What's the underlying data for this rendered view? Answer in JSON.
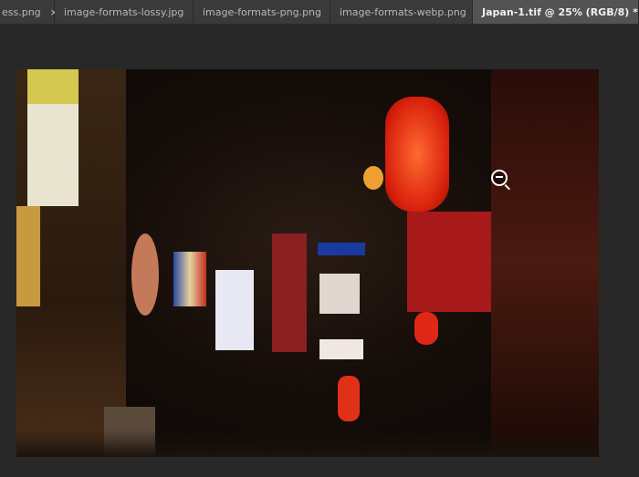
{
  "tabs": [
    {
      "label": "ess.png",
      "active": false
    },
    {
      "label": "image-formats-lossy.jpg",
      "active": false
    },
    {
      "label": "image-formats-png.png",
      "active": false
    },
    {
      "label": "image-formats-webp.png",
      "active": false
    },
    {
      "label": "Japan-1.tif @ 25% (RGB/8) *",
      "active": true
    }
  ],
  "close_glyph": "×",
  "cursor": "zoom-out-icon"
}
